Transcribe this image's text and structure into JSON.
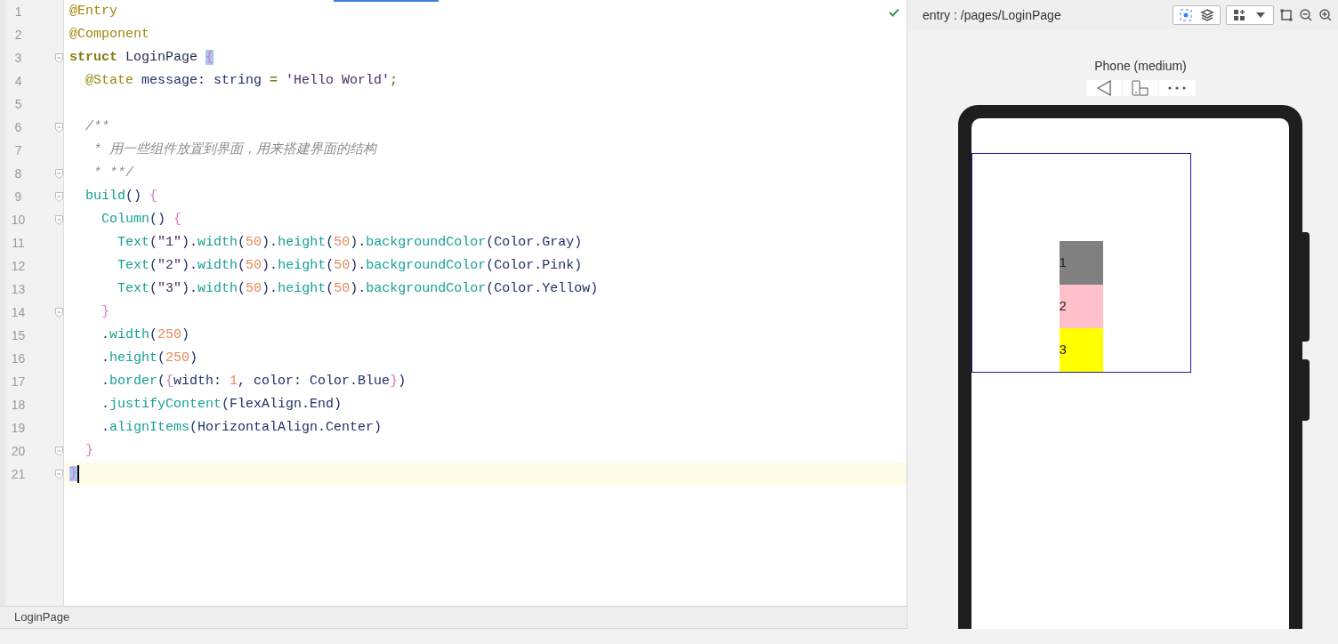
{
  "editor": {
    "lines": [
      {
        "number": "1",
        "fold": false,
        "current": false,
        "tokens": [
          {
            "text": "@Entry",
            "kind": "annotation"
          }
        ]
      },
      {
        "number": "2",
        "fold": false,
        "current": false,
        "tokens": [
          {
            "text": "@Component",
            "kind": "annotation"
          }
        ]
      },
      {
        "number": "3",
        "fold": true,
        "current": false,
        "tokens": [
          {
            "text": "struct",
            "kind": "keyword"
          },
          {
            "text": " LoginPage ",
            "kind": "type"
          },
          {
            "text": "{",
            "kind": "matched-brace"
          }
        ]
      },
      {
        "number": "4",
        "fold": false,
        "current": false,
        "tokens": [
          {
            "text": "  @State",
            "kind": "annotation"
          },
          {
            "text": " message: string ",
            "kind": "plain"
          },
          {
            "text": "= ",
            "kind": "keyword"
          },
          {
            "text": "'Hello World'",
            "kind": "string"
          },
          {
            "text": ";",
            "kind": "keyword"
          }
        ]
      },
      {
        "number": "5",
        "fold": false,
        "current": false
      },
      {
        "number": "6",
        "fold": true,
        "current": false,
        "tokens": [
          {
            "text": "  /**",
            "kind": "comment"
          }
        ]
      },
      {
        "number": "7",
        "fold": false,
        "current": false,
        "tokens": [
          {
            "text": "   * 用一些组件放置到界面，用来搭建界面的结构",
            "kind": "comment"
          }
        ]
      },
      {
        "number": "8",
        "fold": true,
        "current": false,
        "tokens": [
          {
            "text": "   * **/",
            "kind": "comment"
          }
        ]
      },
      {
        "number": "9",
        "fold": true,
        "current": false,
        "tokens": [
          {
            "text": "  build",
            "kind": "fn"
          },
          {
            "text": "() ",
            "kind": "plain"
          },
          {
            "text": "{",
            "kind": "brace"
          }
        ]
      },
      {
        "number": "10",
        "fold": true,
        "current": false,
        "tokens": [
          {
            "text": "    Column",
            "kind": "fn"
          },
          {
            "text": "() ",
            "kind": "plain"
          },
          {
            "text": "{",
            "kind": "brace"
          }
        ]
      },
      {
        "number": "11",
        "fold": false,
        "current": false,
        "tokens": [
          {
            "text": "      Text",
            "kind": "fn"
          },
          {
            "text": "(",
            "kind": "plain"
          },
          {
            "text": "\"1\"",
            "kind": "string"
          },
          {
            "text": ").",
            "kind": "plain"
          },
          {
            "text": "width",
            "kind": "fn"
          },
          {
            "text": "(",
            "kind": "plain"
          },
          {
            "text": "50",
            "kind": "number"
          },
          {
            "text": ").",
            "kind": "plain"
          },
          {
            "text": "height",
            "kind": "fn"
          },
          {
            "text": "(",
            "kind": "plain"
          },
          {
            "text": "50",
            "kind": "number"
          },
          {
            "text": ").",
            "kind": "plain"
          },
          {
            "text": "backgroundColor",
            "kind": "fn"
          },
          {
            "text": "(Color.Gray)",
            "kind": "plain"
          }
        ]
      },
      {
        "number": "12",
        "fold": false,
        "current": false,
        "tokens": [
          {
            "text": "      Text",
            "kind": "fn"
          },
          {
            "text": "(",
            "kind": "plain"
          },
          {
            "text": "\"2\"",
            "kind": "string"
          },
          {
            "text": ").",
            "kind": "plain"
          },
          {
            "text": "width",
            "kind": "fn"
          },
          {
            "text": "(",
            "kind": "plain"
          },
          {
            "text": "50",
            "kind": "number"
          },
          {
            "text": ").",
            "kind": "plain"
          },
          {
            "text": "height",
            "kind": "fn"
          },
          {
            "text": "(",
            "kind": "plain"
          },
          {
            "text": "50",
            "kind": "number"
          },
          {
            "text": ").",
            "kind": "plain"
          },
          {
            "text": "backgroundColor",
            "kind": "fn"
          },
          {
            "text": "(Color.Pink)",
            "kind": "plain"
          }
        ]
      },
      {
        "number": "13",
        "fold": false,
        "current": false,
        "tokens": [
          {
            "text": "      Text",
            "kind": "fn"
          },
          {
            "text": "(",
            "kind": "plain"
          },
          {
            "text": "\"3\"",
            "kind": "string"
          },
          {
            "text": ").",
            "kind": "plain"
          },
          {
            "text": "width",
            "kind": "fn"
          },
          {
            "text": "(",
            "kind": "plain"
          },
          {
            "text": "50",
            "kind": "number"
          },
          {
            "text": ").",
            "kind": "plain"
          },
          {
            "text": "height",
            "kind": "fn"
          },
          {
            "text": "(",
            "kind": "plain"
          },
          {
            "text": "50",
            "kind": "number"
          },
          {
            "text": ").",
            "kind": "plain"
          },
          {
            "text": "backgroundColor",
            "kind": "fn"
          },
          {
            "text": "(Color.Yellow)",
            "kind": "plain"
          }
        ]
      },
      {
        "number": "14",
        "fold": true,
        "current": false,
        "tokens": [
          {
            "text": "    }",
            "kind": "brace"
          }
        ]
      },
      {
        "number": "15",
        "fold": false,
        "current": false,
        "tokens": [
          {
            "text": "    .",
            "kind": "plain"
          },
          {
            "text": "width",
            "kind": "fn"
          },
          {
            "text": "(",
            "kind": "plain"
          },
          {
            "text": "250",
            "kind": "number"
          },
          {
            "text": ")",
            "kind": "plain"
          }
        ]
      },
      {
        "number": "16",
        "fold": false,
        "current": false,
        "tokens": [
          {
            "text": "    .",
            "kind": "plain"
          },
          {
            "text": "height",
            "kind": "fn"
          },
          {
            "text": "(",
            "kind": "plain"
          },
          {
            "text": "250",
            "kind": "number"
          },
          {
            "text": ")",
            "kind": "plain"
          }
        ]
      },
      {
        "number": "17",
        "fold": false,
        "current": false,
        "tokens": [
          {
            "text": "    .",
            "kind": "plain"
          },
          {
            "text": "border",
            "kind": "fn"
          },
          {
            "text": "(",
            "kind": "plain"
          },
          {
            "text": "{",
            "kind": "brace"
          },
          {
            "text": "width: ",
            "kind": "plain"
          },
          {
            "text": "1",
            "kind": "number"
          },
          {
            "text": ", color: Color.Blue",
            "kind": "plain"
          },
          {
            "text": "}",
            "kind": "brace"
          },
          {
            "text": ")",
            "kind": "plain"
          }
        ]
      },
      {
        "number": "18",
        "fold": false,
        "current": false,
        "tokens": [
          {
            "text": "    .",
            "kind": "plain"
          },
          {
            "text": "justifyContent",
            "kind": "fn"
          },
          {
            "text": "(FlexAlign.End)",
            "kind": "plain"
          }
        ]
      },
      {
        "number": "19",
        "fold": false,
        "current": false,
        "tokens": [
          {
            "text": "    .",
            "kind": "plain"
          },
          {
            "text": "alignItems",
            "kind": "fn"
          },
          {
            "text": "(HorizontalAlign.Center)",
            "kind": "plain"
          }
        ]
      },
      {
        "number": "20",
        "fold": true,
        "current": false,
        "tokens": [
          {
            "text": "  }",
            "kind": "brace"
          }
        ]
      },
      {
        "number": "21",
        "fold": true,
        "current": true,
        "tokens": [
          {
            "text": "}",
            "kind": "matched-brace"
          }
        ]
      }
    ],
    "status_bar": {
      "breadcrumb": "LoginPage"
    }
  },
  "previewer": {
    "path": "entry : /pages/LoginPage",
    "device": "Phone (medium)",
    "blocks": [
      {
        "text": "1",
        "color": "#808080"
      },
      {
        "text": "2",
        "color": "#ffc0cb"
      },
      {
        "text": "3",
        "color": "#ffff00"
      }
    ]
  }
}
